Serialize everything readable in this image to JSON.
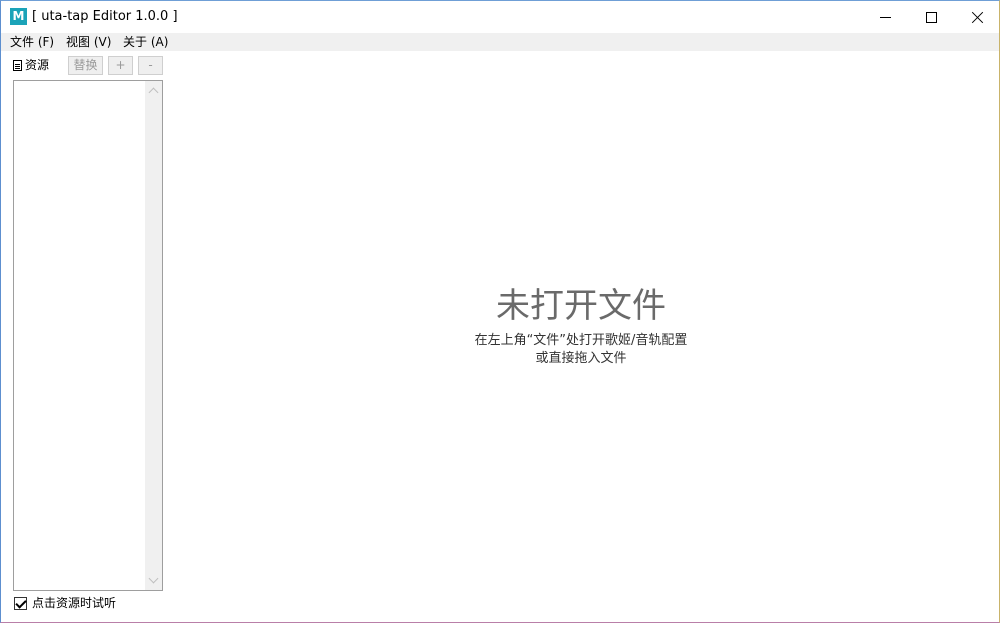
{
  "window": {
    "title": "[ uta-tap Editor 1.0.0 ]",
    "app_icon_letter": "M",
    "accent_color": "#1ba3b8"
  },
  "menu": {
    "items": [
      {
        "label": "文件 (F)"
      },
      {
        "label": "视图 (V)"
      },
      {
        "label": "关于 (A)"
      }
    ]
  },
  "sidebar": {
    "resources_label": "资源",
    "replace_label": "替换",
    "add_label": "+",
    "remove_label": "-",
    "items": [],
    "preview_checkbox": {
      "label": "点击资源时试听",
      "checked": true
    }
  },
  "main": {
    "empty_title": "未打开文件",
    "empty_hint_line1": "在左上角“文件”处打开歌姬/音轨配置",
    "empty_hint_line2": "或直接拖入文件"
  }
}
